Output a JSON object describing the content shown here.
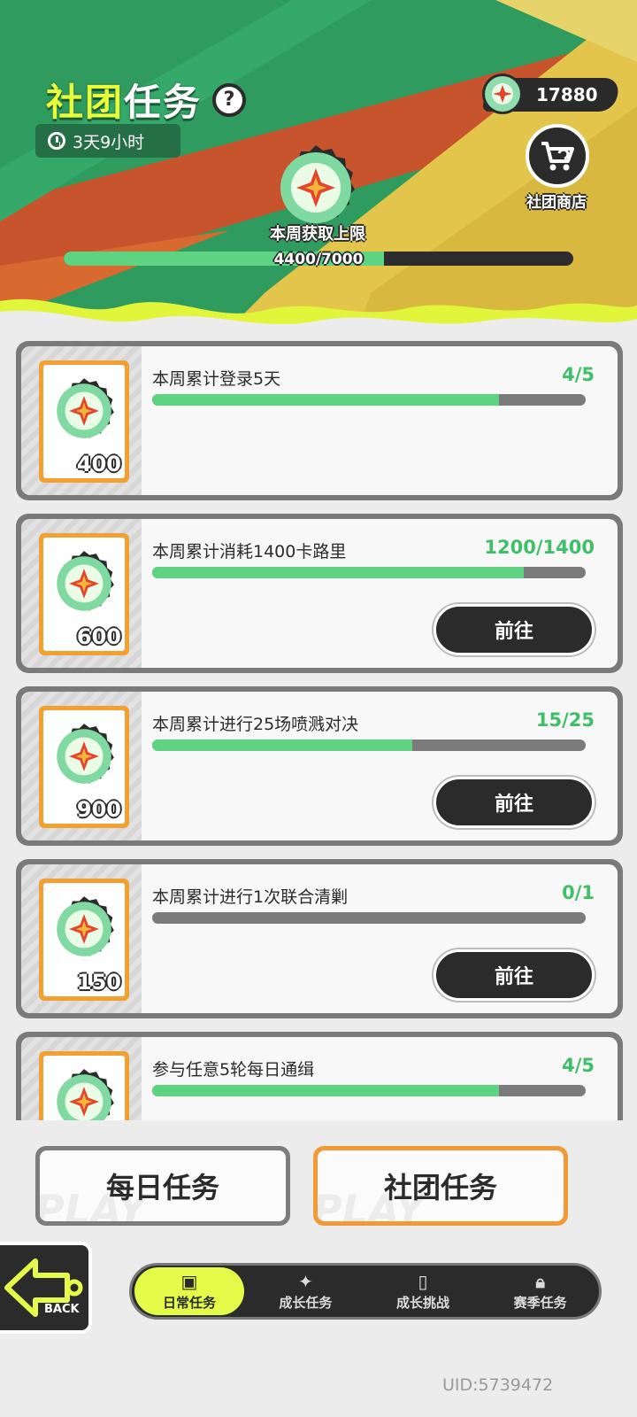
{
  "header": {
    "title_part1": "社团",
    "title_part2": "任务",
    "help_icon": "?",
    "timer": "3天9小时",
    "currency_amount": "17880",
    "shop_label": "社团商店",
    "weekly_label": "本周获取上限",
    "weekly_progress_text": "4400/7000",
    "weekly_progress_fraction": 0.6286
  },
  "tasks": [
    {
      "name": "本周累计登录5天",
      "progress": "4/5",
      "fraction": 0.8,
      "reward": "400",
      "button": ""
    },
    {
      "name": "本周累计消耗1400卡路里",
      "progress": "1200/1400",
      "fraction": 0.857,
      "reward": "600",
      "button": "前往"
    },
    {
      "name": "本周累计进行25场喷溅对决",
      "progress": "15/25",
      "fraction": 0.6,
      "reward": "900",
      "button": "前往"
    },
    {
      "name": "本周累计进行1次联合清剿",
      "progress": "0/1",
      "fraction": 0.0,
      "reward": "150",
      "button": "前往"
    },
    {
      "name": "参与任意5轮每日通缉",
      "progress": "4/5",
      "fraction": 0.8,
      "reward": "",
      "button": ""
    }
  ],
  "segments": {
    "daily": "每日任务",
    "club": "社团任务",
    "ghost": "PLAY"
  },
  "back_label": "BACK",
  "nav": [
    {
      "label": "日常任务",
      "icon": "calendar-check-icon"
    },
    {
      "label": "成长任务",
      "icon": "sparkle-icon"
    },
    {
      "label": "成长挑战",
      "icon": "id-card-icon"
    },
    {
      "label": "赛季任务",
      "icon": "lock-icon"
    }
  ],
  "uid": "UID:5739472",
  "colors": {
    "accent_green": "#5ed381",
    "accent_yellow": "#e4fb4a",
    "accent_orange": "#f19a3a",
    "dark": "#2b2b2b"
  }
}
